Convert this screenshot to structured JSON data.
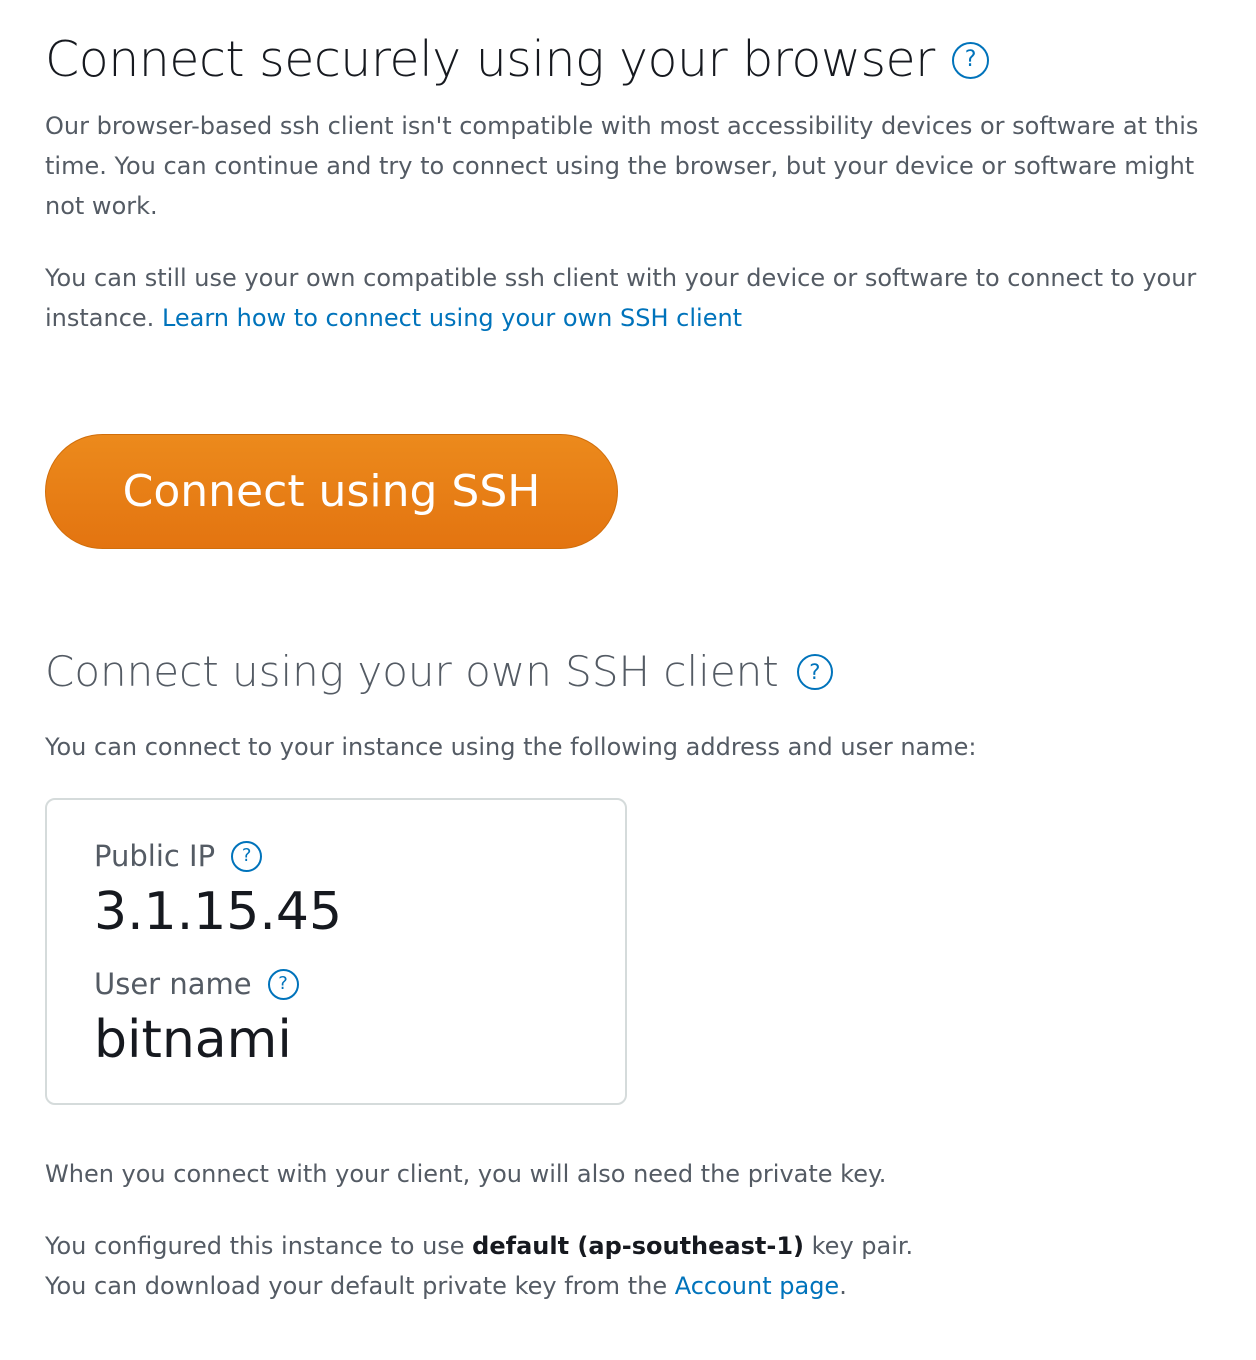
{
  "browser_section": {
    "title": "Connect securely using your browser",
    "help_icon": "question-circle-icon",
    "paragraph1": "Our browser-based ssh client isn't compatible with most accessibility devices or software at this time. You can continue and try to connect using the browser, but your device or software might not work.",
    "paragraph2_text": "You can still use your own compatible ssh client with your device or software to connect to your instance. ",
    "paragraph2_link": "Learn how to connect using your own SSH client",
    "connect_button": "Connect using SSH"
  },
  "own_client_section": {
    "title": "Connect using your own SSH client",
    "help_icon": "question-circle-icon",
    "intro": "You can connect to your instance using the following address and user name:",
    "public_ip_label": "Public IP",
    "public_ip_value": "3.1.15.45",
    "user_name_label": "User name",
    "user_name_value": "bitnami",
    "private_key_note": "When you connect with your client, you will also need the private key.",
    "key_pair_prefix": "You configured this instance to use ",
    "key_pair_name": "default (ap-southeast-1)",
    "key_pair_suffix": " key pair.",
    "download_prefix": "You can download your default private key from the ",
    "download_link": "Account page",
    "download_suffix": "."
  },
  "colors": {
    "accent_orange": "#ec7211",
    "link_blue": "#0073bb",
    "heading_dark": "#16191f",
    "body_gray": "#545b64",
    "border_gray": "#d5dbdb"
  }
}
